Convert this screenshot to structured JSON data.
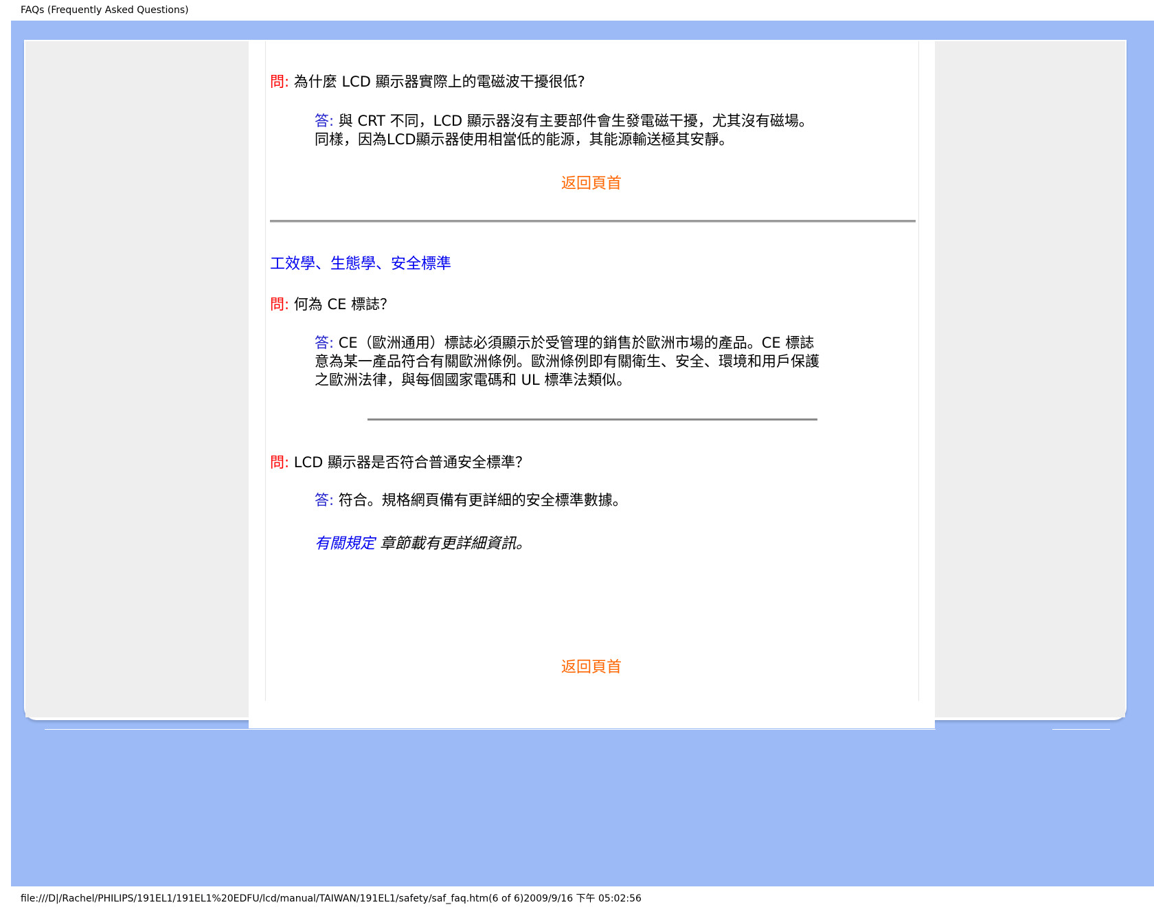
{
  "header": {
    "title": "FAQs (Frequently Asked Questions)"
  },
  "footer": {
    "path": "file:///D|/Rachel/PHILIPS/191EL1/191EL1%20EDFU/lcd/manual/TAIWAN/191EL1/safety/saf_faq.htm(6 of 6)2009/9/16 下午 05:02:56"
  },
  "labels": {
    "question": "問:",
    "answer": "答:"
  },
  "faq1": {
    "question": "為什麼 LCD 顯示器實際上的電磁波干擾很低?",
    "answer_lines": [
      "與 CRT  不同，LCD 顯示器沒有主要部件會生發電磁干擾，尤其沒有磁場。",
      "同樣，因為LCD顯示器使用相當低的能源，其能源輸送極其安靜。"
    ]
  },
  "back_to_top": "返回頁首",
  "section": {
    "title": "工效學、生態學、安全標準"
  },
  "faq2": {
    "question": "何為 CE 標誌？",
    "answer_lines": [
      "CE（歐洲通用）標誌必須顯示於受管理的銷售於歐洲市場的產品。CE 標誌",
      "意為某一產品符合有關歐洲條例。歐洲條例即有關衛生、安全、環境和用戶保護",
      "之歐洲法律，與每個國家電碼和 UL  標準法類似。"
    ]
  },
  "faq3": {
    "question": "LCD 顯示器是否符合普通安全標準？",
    "answer": "符合。規格網頁備有更詳細的安全標準數據。"
  },
  "regulatory": {
    "link_text": "有關規定",
    "suffix": " 章節載有更詳細資訊。"
  },
  "colors": {
    "background": "#9bbaf6",
    "question_tag": "#ff0000",
    "answer_tag": "#2222cc",
    "link": "#0000ee",
    "back_to_top": "#ff6600"
  }
}
